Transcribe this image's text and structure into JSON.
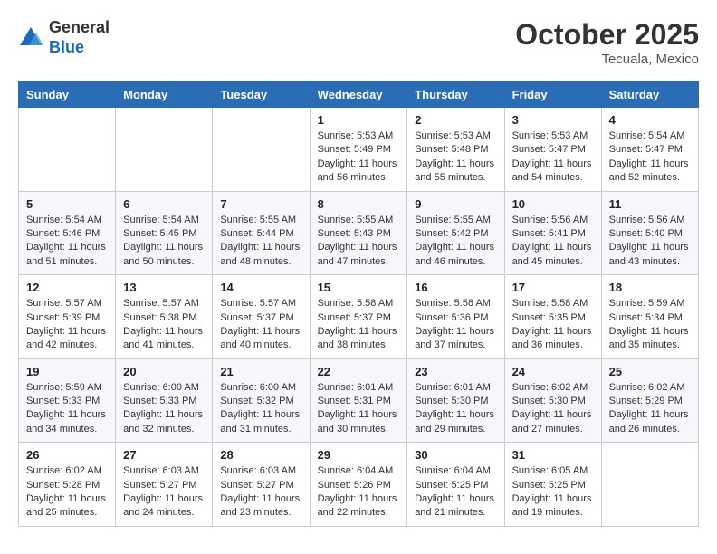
{
  "header": {
    "logo_general": "General",
    "logo_blue": "Blue",
    "month_title": "October 2025",
    "location": "Tecuala, Mexico"
  },
  "weekdays": [
    "Sunday",
    "Monday",
    "Tuesday",
    "Wednesday",
    "Thursday",
    "Friday",
    "Saturday"
  ],
  "weeks": [
    [
      {
        "day": "",
        "info": ""
      },
      {
        "day": "",
        "info": ""
      },
      {
        "day": "",
        "info": ""
      },
      {
        "day": "1",
        "info": "Sunrise: 5:53 AM\nSunset: 5:49 PM\nDaylight: 11 hours and 56 minutes."
      },
      {
        "day": "2",
        "info": "Sunrise: 5:53 AM\nSunset: 5:48 PM\nDaylight: 11 hours and 55 minutes."
      },
      {
        "day": "3",
        "info": "Sunrise: 5:53 AM\nSunset: 5:47 PM\nDaylight: 11 hours and 54 minutes."
      },
      {
        "day": "4",
        "info": "Sunrise: 5:54 AM\nSunset: 5:47 PM\nDaylight: 11 hours and 52 minutes."
      }
    ],
    [
      {
        "day": "5",
        "info": "Sunrise: 5:54 AM\nSunset: 5:46 PM\nDaylight: 11 hours and 51 minutes."
      },
      {
        "day": "6",
        "info": "Sunrise: 5:54 AM\nSunset: 5:45 PM\nDaylight: 11 hours and 50 minutes."
      },
      {
        "day": "7",
        "info": "Sunrise: 5:55 AM\nSunset: 5:44 PM\nDaylight: 11 hours and 48 minutes."
      },
      {
        "day": "8",
        "info": "Sunrise: 5:55 AM\nSunset: 5:43 PM\nDaylight: 11 hours and 47 minutes."
      },
      {
        "day": "9",
        "info": "Sunrise: 5:55 AM\nSunset: 5:42 PM\nDaylight: 11 hours and 46 minutes."
      },
      {
        "day": "10",
        "info": "Sunrise: 5:56 AM\nSunset: 5:41 PM\nDaylight: 11 hours and 45 minutes."
      },
      {
        "day": "11",
        "info": "Sunrise: 5:56 AM\nSunset: 5:40 PM\nDaylight: 11 hours and 43 minutes."
      }
    ],
    [
      {
        "day": "12",
        "info": "Sunrise: 5:57 AM\nSunset: 5:39 PM\nDaylight: 11 hours and 42 minutes."
      },
      {
        "day": "13",
        "info": "Sunrise: 5:57 AM\nSunset: 5:38 PM\nDaylight: 11 hours and 41 minutes."
      },
      {
        "day": "14",
        "info": "Sunrise: 5:57 AM\nSunset: 5:37 PM\nDaylight: 11 hours and 40 minutes."
      },
      {
        "day": "15",
        "info": "Sunrise: 5:58 AM\nSunset: 5:37 PM\nDaylight: 11 hours and 38 minutes."
      },
      {
        "day": "16",
        "info": "Sunrise: 5:58 AM\nSunset: 5:36 PM\nDaylight: 11 hours and 37 minutes."
      },
      {
        "day": "17",
        "info": "Sunrise: 5:58 AM\nSunset: 5:35 PM\nDaylight: 11 hours and 36 minutes."
      },
      {
        "day": "18",
        "info": "Sunrise: 5:59 AM\nSunset: 5:34 PM\nDaylight: 11 hours and 35 minutes."
      }
    ],
    [
      {
        "day": "19",
        "info": "Sunrise: 5:59 AM\nSunset: 5:33 PM\nDaylight: 11 hours and 34 minutes."
      },
      {
        "day": "20",
        "info": "Sunrise: 6:00 AM\nSunset: 5:33 PM\nDaylight: 11 hours and 32 minutes."
      },
      {
        "day": "21",
        "info": "Sunrise: 6:00 AM\nSunset: 5:32 PM\nDaylight: 11 hours and 31 minutes."
      },
      {
        "day": "22",
        "info": "Sunrise: 6:01 AM\nSunset: 5:31 PM\nDaylight: 11 hours and 30 minutes."
      },
      {
        "day": "23",
        "info": "Sunrise: 6:01 AM\nSunset: 5:30 PM\nDaylight: 11 hours and 29 minutes."
      },
      {
        "day": "24",
        "info": "Sunrise: 6:02 AM\nSunset: 5:30 PM\nDaylight: 11 hours and 27 minutes."
      },
      {
        "day": "25",
        "info": "Sunrise: 6:02 AM\nSunset: 5:29 PM\nDaylight: 11 hours and 26 minutes."
      }
    ],
    [
      {
        "day": "26",
        "info": "Sunrise: 6:02 AM\nSunset: 5:28 PM\nDaylight: 11 hours and 25 minutes."
      },
      {
        "day": "27",
        "info": "Sunrise: 6:03 AM\nSunset: 5:27 PM\nDaylight: 11 hours and 24 minutes."
      },
      {
        "day": "28",
        "info": "Sunrise: 6:03 AM\nSunset: 5:27 PM\nDaylight: 11 hours and 23 minutes."
      },
      {
        "day": "29",
        "info": "Sunrise: 6:04 AM\nSunset: 5:26 PM\nDaylight: 11 hours and 22 minutes."
      },
      {
        "day": "30",
        "info": "Sunrise: 6:04 AM\nSunset: 5:25 PM\nDaylight: 11 hours and 21 minutes."
      },
      {
        "day": "31",
        "info": "Sunrise: 6:05 AM\nSunset: 5:25 PM\nDaylight: 11 hours and 19 minutes."
      },
      {
        "day": "",
        "info": ""
      }
    ]
  ]
}
